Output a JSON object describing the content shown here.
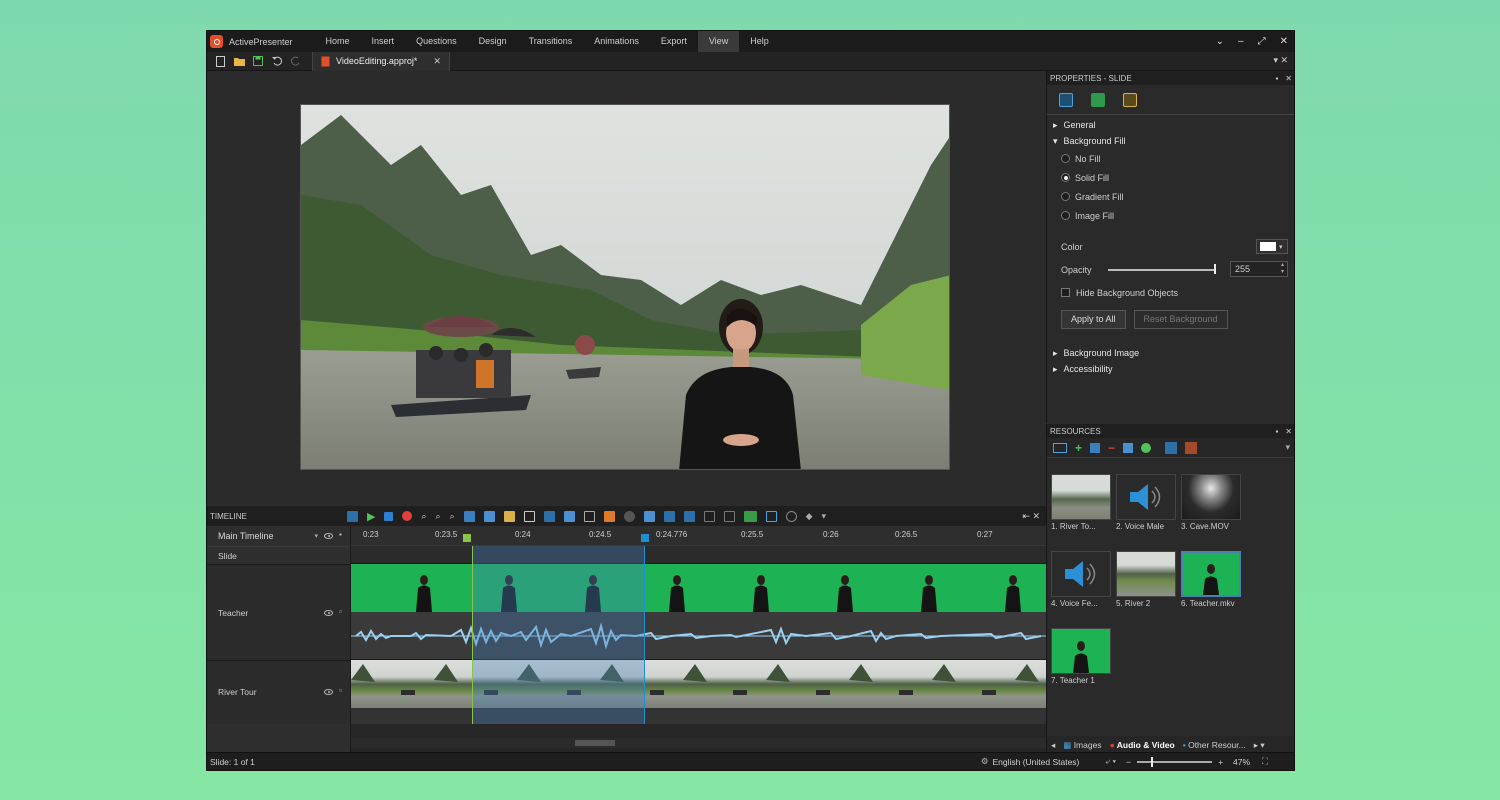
{
  "app": {
    "name": "ActivePresenter",
    "menu": [
      "Home",
      "Insert",
      "Questions",
      "Design",
      "Transitions",
      "Animations",
      "Export",
      "View",
      "Help"
    ],
    "active_menu": "View",
    "window_controls": [
      "⌄",
      "–",
      "⤢",
      "✕"
    ]
  },
  "document_tab": {
    "label": "VideoEditing.approj*",
    "close": "✕"
  },
  "properties": {
    "title": "PROPERTIES - SLIDE",
    "sections": {
      "general": "General",
      "background_fill": "Background Fill",
      "background_image": "Background Image",
      "accessibility": "Accessibility"
    },
    "fill_options": [
      "No Fill",
      "Solid Fill",
      "Gradient Fill",
      "Image Fill"
    ],
    "selected_fill": "Solid Fill",
    "color_label": "Color",
    "opacity_label": "Opacity",
    "opacity_value": "255",
    "hide_bg_label": "Hide Background Objects",
    "apply_all": "Apply to All",
    "reset_bg": "Reset Background"
  },
  "resources": {
    "title": "RESOURCES",
    "items": [
      "1. River To...",
      "2. Voice Male",
      "3. Cave.MOV",
      "4. Voice Fe...",
      "5. River 2",
      "6. Teacher.mkv",
      "7. Teacher 1"
    ],
    "tabs": [
      "Images",
      "Audio & Video",
      "Other Resour..."
    ],
    "active_tab": "Audio & Video"
  },
  "timeline": {
    "title": "TIMELINE",
    "main_timeline": "Main Timeline",
    "ruler": [
      "0:23",
      "0:23.5",
      "0:24",
      "0:24.5",
      "0:24.776",
      "0:25.5",
      "0:26",
      "0:26.5",
      "0:27"
    ],
    "tracks": [
      "Slide",
      "Teacher",
      "River Tour"
    ]
  },
  "status": {
    "slide": "Slide: 1 of 1",
    "language": "English (United States)",
    "zoom": "47%"
  },
  "colors": {
    "green_screen": "#1db254",
    "selection": "#3f6f96",
    "accent_blue": "#1e90d0"
  }
}
